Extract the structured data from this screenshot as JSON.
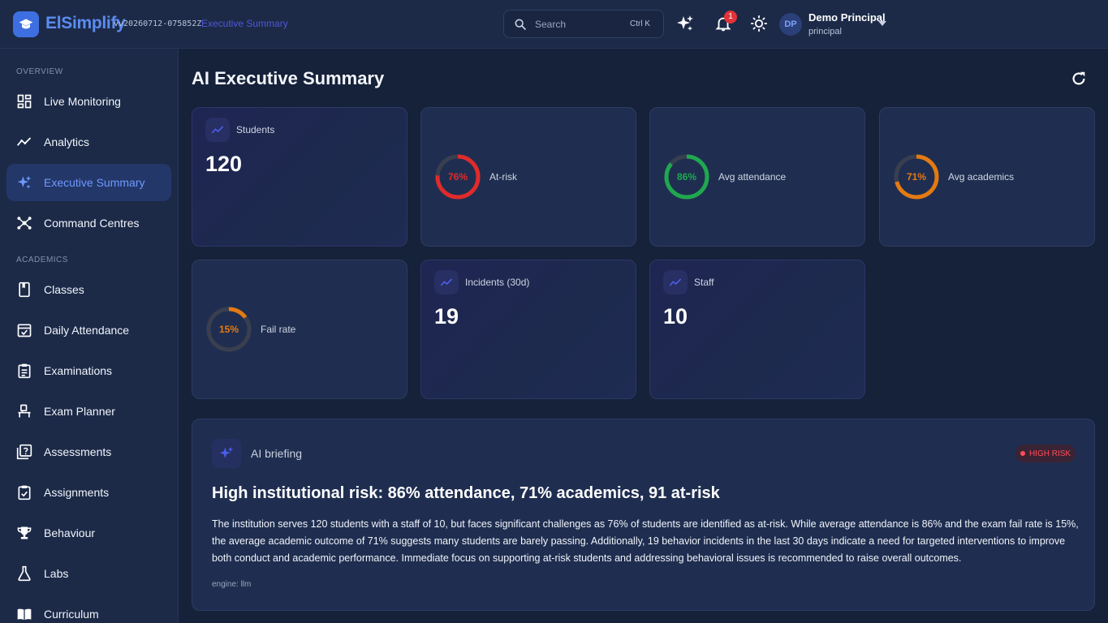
{
  "app": {
    "brand": "ElSimplify",
    "version": "vv20260712-075852Z",
    "breadcrumb": "Executive Summary"
  },
  "search": {
    "placeholder": "Search",
    "shortcut": "Ctrl K"
  },
  "notifications": {
    "count": "1"
  },
  "user": {
    "initials": "DP",
    "name": "Demo Principal",
    "role": "principal"
  },
  "sidebar": {
    "sections": [
      {
        "title": "OVERVIEW",
        "items": [
          {
            "label": "Live Monitoring",
            "icon": "dashboard-icon"
          },
          {
            "label": "Analytics",
            "icon": "trend-icon"
          },
          {
            "label": "Executive Summary",
            "icon": "sparkle-icon",
            "active": true
          },
          {
            "label": "Command Centres",
            "icon": "hub-icon"
          }
        ]
      },
      {
        "title": "ACADEMICS",
        "items": [
          {
            "label": "Classes",
            "icon": "book-icon"
          },
          {
            "label": "Daily Attendance",
            "icon": "calendar-check-icon"
          },
          {
            "label": "Examinations",
            "icon": "clipboard-list-icon"
          },
          {
            "label": "Exam Planner",
            "icon": "desk-icon"
          },
          {
            "label": "Assessments",
            "icon": "question-box-icon"
          },
          {
            "label": "Assignments",
            "icon": "clipboard-check-icon"
          },
          {
            "label": "Behaviour",
            "icon": "trophy-icon"
          },
          {
            "label": "Labs",
            "icon": "flask-icon"
          },
          {
            "label": "Curriculum",
            "icon": "open-book-icon"
          }
        ]
      }
    ]
  },
  "main": {
    "title": "AI Executive Summary",
    "stats": [
      {
        "label": "Students",
        "value": "120"
      },
      {
        "label": "Incidents (30d)",
        "value": "19"
      },
      {
        "label": "Staff",
        "value": "10"
      }
    ],
    "rings": [
      {
        "label": "At-risk",
        "percent": 76,
        "text": "76%",
        "color": "#e02b2b"
      },
      {
        "label": "Avg attendance",
        "percent": 86,
        "text": "86%",
        "color": "#1fa84f"
      },
      {
        "label": "Avg academics",
        "percent": 71,
        "text": "71%",
        "color": "#e47a12"
      },
      {
        "label": "Fail rate",
        "percent": 15,
        "text": "15%",
        "color": "#e47a12"
      }
    ],
    "briefing": {
      "label": "AI briefing",
      "risk": "HIGH RISK",
      "headline": "High institutional risk: 86% attendance, 71% academics, 91 at-risk",
      "body": "The institution serves 120 students with a staff of 10, but faces significant challenges as 76% of students are identified as at-risk. While average attendance is 86% and the exam fail rate is 15%, the average academic outcome of 71% suggests many students are barely passing. Additionally, 19 behavior incidents in the last 30 days indicate a need for targeted interventions to improve both conduct and academic performance. Immediate focus on supporting at-risk students and addressing behavioral issues is recommended to raise overall outcomes.",
      "engine": "engine: llm"
    }
  }
}
